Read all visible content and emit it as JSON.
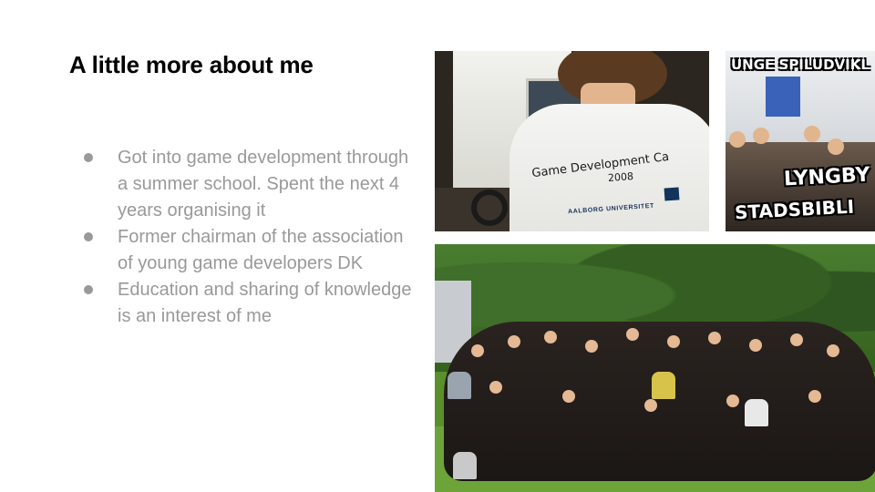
{
  "slide": {
    "title": "A little more about me",
    "bullets": [
      "Got into game development through a summer school. Spent the next 4 years organising it",
      "Former chairman of the association of young game developers DK",
      "Education and sharing of knowledge is an interest of me"
    ]
  },
  "photos": {
    "tshirt": {
      "shirt_line1": "Game Development Ca",
      "shirt_line2": "2008",
      "shirt_university": "AALBORG UNIVERSITET"
    },
    "library": {
      "banner_top": "UNGE SPILUDVIKL",
      "banner_mid": "LYNGBY",
      "banner_bottom": "STADSBIBLI"
    }
  },
  "colors": {
    "title": "#000000",
    "bullet_text": "#999999",
    "background": "#ffffff"
  }
}
